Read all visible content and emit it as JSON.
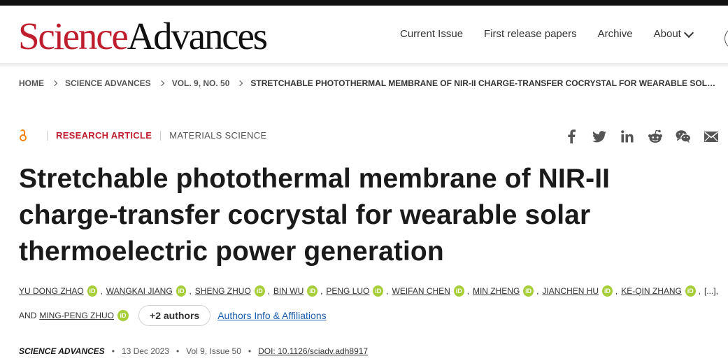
{
  "header": {
    "logo_part1": "Science",
    "logo_part2": "Advances",
    "nav": [
      "Current Issue",
      "First release papers",
      "Archive",
      "About"
    ]
  },
  "breadcrumb": {
    "items": [
      "HOME",
      "SCIENCE ADVANCES",
      "VOL. 9, NO. 50"
    ],
    "current": "STRETCHABLE PHOTOTHERMAL MEMBRANE OF NIR-II CHARGE-TRANSFER COCRYSTAL FOR WEARABLE SOLA..."
  },
  "article": {
    "type": "RESEARCH ARTICLE",
    "subject": "MATERIALS SCIENCE",
    "title": "Stretchable photothermal membrane of NIR-II charge-transfer cocrystal for wearable solar thermoelectric power generation",
    "authors": [
      "YU DONG ZHAO",
      "WANGKAI JIANG",
      "SHENG ZHUO",
      "BIN WU",
      "PENG LUO",
      "WEIFAN CHEN",
      "MIN ZHENG",
      "JIANCHEN HU",
      "KE-QIN ZHANG"
    ],
    "orcid_label": "iD",
    "ellipsis": "[...],",
    "and_text": "AND",
    "last_author": "MING-PENG ZHUO",
    "more_authors": "+2 authors",
    "affiliations_link": "Authors Info & Affiliations"
  },
  "citation": {
    "journal": "SCIENCE ADVANCES",
    "separator": "•",
    "date": "13 Dec 2023",
    "volume": "Vol 9, Issue 50",
    "doi": "DOI: 10.1126/sciadv.adh8917"
  },
  "share_icons": [
    "facebook-icon",
    "twitter-icon",
    "linkedin-icon",
    "reddit-icon",
    "wechat-icon",
    "email-icon"
  ],
  "colors": {
    "brand_red": "#bf1e2e",
    "open_access_orange": "#f68212",
    "orcid_green": "#a6ce39",
    "link_blue": "#1a5faf"
  }
}
